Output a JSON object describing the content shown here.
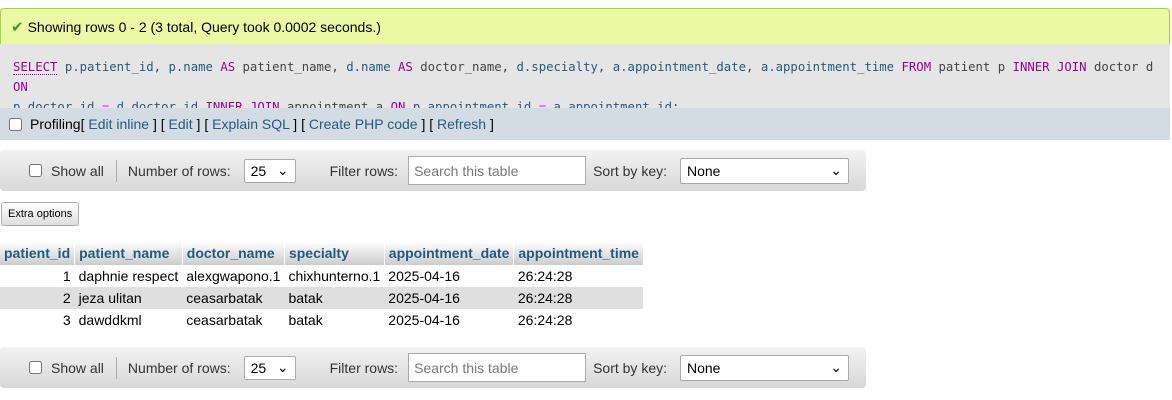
{
  "message": {
    "icon": "check-icon",
    "text": "Showing rows 0 - 2 (3 total, Query took 0.0002 seconds.)"
  },
  "sql": {
    "line1": [
      {
        "t": "SELECT",
        "c": "sel"
      },
      {
        "t": " "
      },
      {
        "t": "p.patient_id",
        "c": "id"
      },
      {
        "t": ", "
      },
      {
        "t": "p.name",
        "c": "id"
      },
      {
        "t": " "
      },
      {
        "t": "AS",
        "c": "kw"
      },
      {
        "t": " patient_name, "
      },
      {
        "t": "d.name",
        "c": "id"
      },
      {
        "t": " "
      },
      {
        "t": "AS",
        "c": "kw"
      },
      {
        "t": " doctor_name, "
      },
      {
        "t": "d.specialty",
        "c": "id"
      },
      {
        "t": ", "
      },
      {
        "t": "a.appointment_date",
        "c": "id"
      },
      {
        "t": ", "
      },
      {
        "t": "a.appointment_time",
        "c": "id"
      },
      {
        "t": " "
      },
      {
        "t": "FROM",
        "c": "kw"
      },
      {
        "t": " patient p "
      },
      {
        "t": "INNER JOIN",
        "c": "kw"
      },
      {
        "t": " doctor d "
      },
      {
        "t": "ON",
        "c": "kw"
      }
    ],
    "line2": [
      {
        "t": "p.doctor_id",
        "c": "id"
      },
      {
        "t": " "
      },
      {
        "t": "=",
        "c": "op"
      },
      {
        "t": " "
      },
      {
        "t": "d.doctor_id",
        "c": "id"
      },
      {
        "t": " "
      },
      {
        "t": "INNER JOIN",
        "c": "kw"
      },
      {
        "t": " appointment a "
      },
      {
        "t": "ON",
        "c": "kw"
      },
      {
        "t": " "
      },
      {
        "t": "p.appointment_id",
        "c": "id"
      },
      {
        "t": " "
      },
      {
        "t": "=",
        "c": "op"
      },
      {
        "t": " "
      },
      {
        "t": "a.appointment_id",
        "c": "id"
      },
      {
        "t": ";"
      }
    ]
  },
  "profiling": {
    "label": "Profiling",
    "links": [
      "Edit inline",
      "Edit",
      "Explain SQL",
      "Create PHP code",
      "Refresh"
    ]
  },
  "nav": {
    "show_all": "Show all",
    "rows_label": "Number of rows:",
    "rows_value": "25",
    "filter_label": "Filter rows:",
    "filter_placeholder": "Search this table",
    "sort_label": "Sort by key:",
    "sort_value": "None"
  },
  "extra_options": "Extra options",
  "table": {
    "columns": [
      "patient_id",
      "patient_name",
      "doctor_name",
      "specialty",
      "appointment_date",
      "appointment_time"
    ],
    "rows": [
      [
        "1",
        "daphnie respect",
        "alexgwapono.1",
        "chixhunterno.1",
        "2025-04-16",
        "26:24:28"
      ],
      [
        "2",
        "jeza ulitan",
        "ceasarbatak",
        "batak",
        "2025-04-16",
        "26:24:28"
      ],
      [
        "3",
        "dawddkml",
        "ceasarbatak",
        "batak",
        "2025-04-16",
        "26:24:28"
      ]
    ]
  }
}
